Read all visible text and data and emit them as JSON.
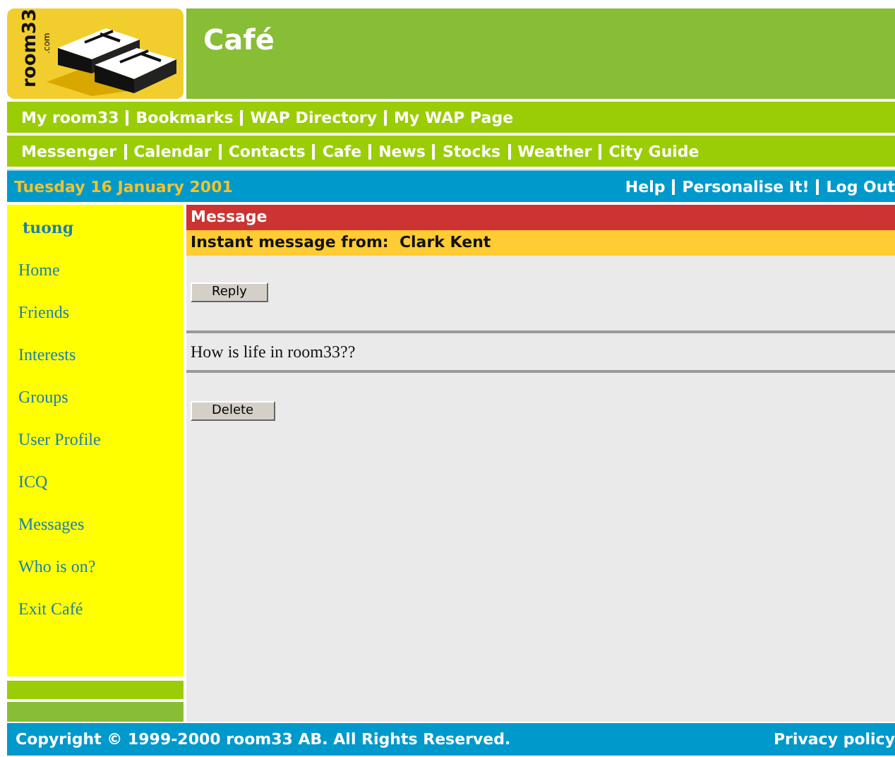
{
  "logo": {
    "text": "room33",
    "suffix": ".com"
  },
  "header": {
    "title": "Café"
  },
  "nav_rows": [
    {
      "items": [
        "My room33",
        "Bookmarks",
        "WAP Directory",
        "My WAP Page"
      ]
    },
    {
      "items": [
        "Messenger",
        "Calendar",
        "Contacts",
        "Cafe",
        "News",
        "Stocks",
        "Weather",
        "City Guide"
      ]
    }
  ],
  "date_bar": {
    "date": "Tuesday 16 January 2001",
    "links": [
      "Help",
      "Personalise It!",
      "Log Out"
    ]
  },
  "sidebar": {
    "user": "tuong",
    "items": [
      "Home",
      "Friends",
      "Interests",
      "Groups",
      "User Profile",
      "ICQ",
      "Messages",
      "Who is on?",
      "Exit Café"
    ]
  },
  "message": {
    "title": "Message",
    "from_label": "Instant message from:",
    "sender": "Clark Kent",
    "reply_button": "Reply",
    "body": "How is life in room33??",
    "delete_button": "Delete"
  },
  "footer": {
    "copyright": "Copyright © 1999-2000 room33 AB. All Rights Reserved.",
    "link": "Privacy policy"
  }
}
